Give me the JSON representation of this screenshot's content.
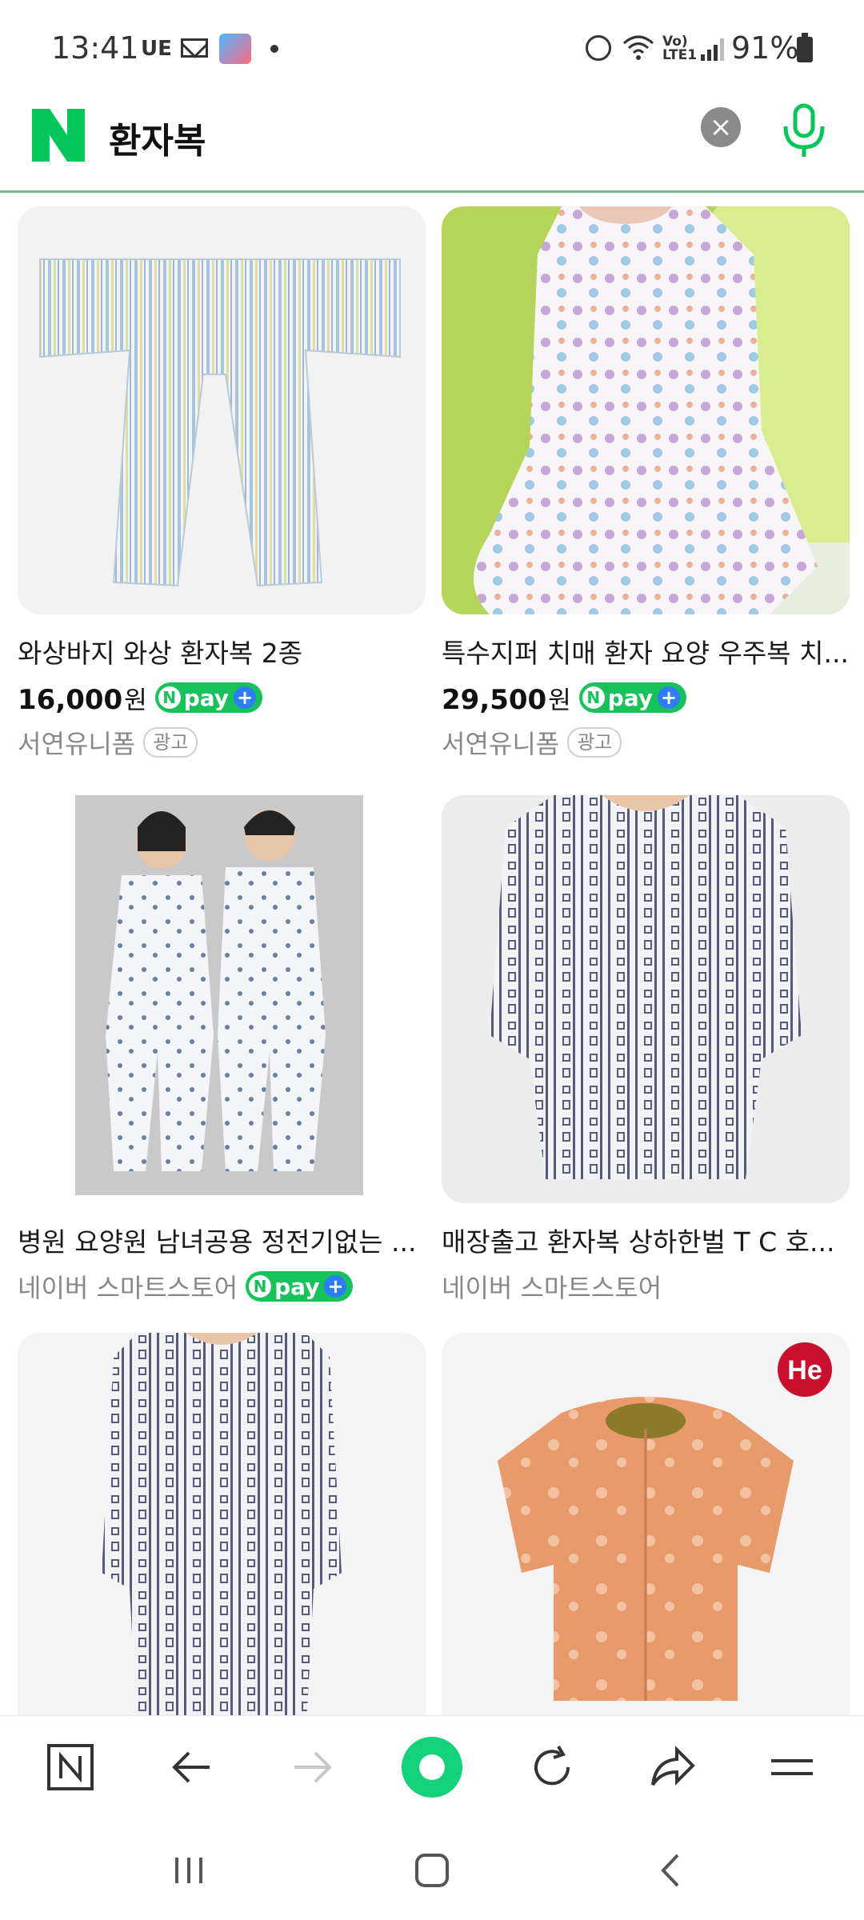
{
  "status_bar": {
    "time": "13:41",
    "carrier": "UE",
    "battery": "91%",
    "icons": [
      "mail-icon",
      "app-icon",
      "dot-icon",
      "alarm-icon",
      "wifi-icon",
      "volte-icon",
      "signal-icon",
      "battery-icon"
    ]
  },
  "search": {
    "logo": "N",
    "query": "환자복",
    "clear_icon": "×"
  },
  "products": [
    {
      "title": "와상바지 와상 환자복 2종",
      "price": "16,000",
      "currency": "원",
      "npay": true,
      "seller": "서연유니폼",
      "ad": "광고"
    },
    {
      "title": "특수지퍼 치매 환자 요양 우주복 치...",
      "price": "29,500",
      "currency": "원",
      "npay": true,
      "seller": "서연유니폼",
      "ad": "광고"
    },
    {
      "title": "병원 요양원 남녀공용 정전기없는 ...",
      "seller": "네이버 스마트스토어",
      "npay": true
    },
    {
      "title": "매장출고 환자복 상하한벌 T C 호...",
      "seller": "네이버 스마트스토어"
    },
    {
      "badge": "He"
    },
    {}
  ],
  "npay_label": "pay",
  "toolbar": {
    "items": [
      "naver-home",
      "back",
      "forward",
      "green-dot",
      "reload",
      "share",
      "menu"
    ]
  },
  "colors": {
    "naver_green": "#03c75a",
    "header_border": "#6bbf8e",
    "npay_green": "#16c25a",
    "npay_plus_blue": "#2e7dff"
  }
}
